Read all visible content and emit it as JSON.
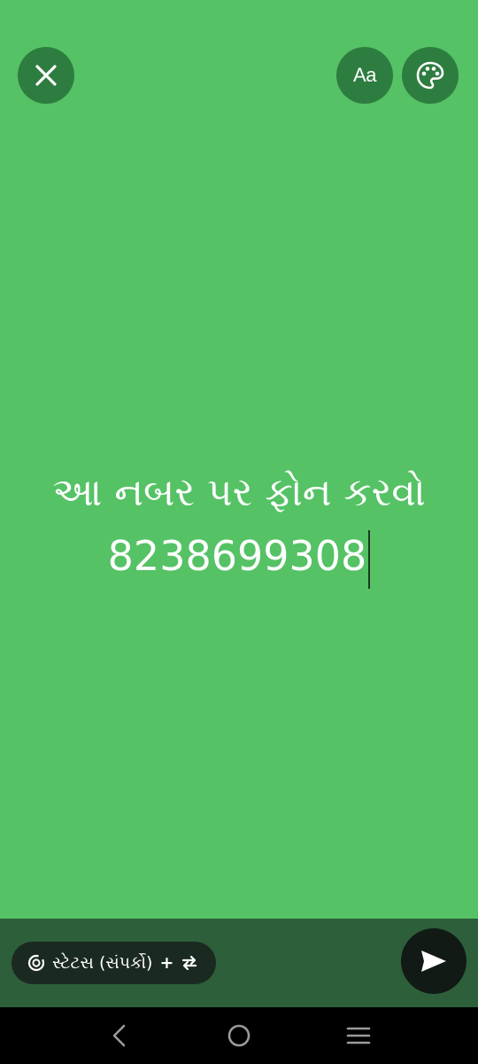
{
  "editor": {
    "background_color": "#55c265",
    "text_lines": [
      "આ નબર પર ફોન કરવો",
      "8238699308"
    ]
  },
  "toolbar": {
    "close_icon": "close-icon",
    "font_label": "Aa",
    "palette_icon": "palette-icon"
  },
  "footer": {
    "audience_label": "સ્ટેટસ (સંપર્કો)",
    "audience_plus": "+",
    "send_icon": "send-icon"
  },
  "navbar": {
    "icons": [
      "back-icon",
      "home-icon",
      "recents-icon"
    ]
  }
}
